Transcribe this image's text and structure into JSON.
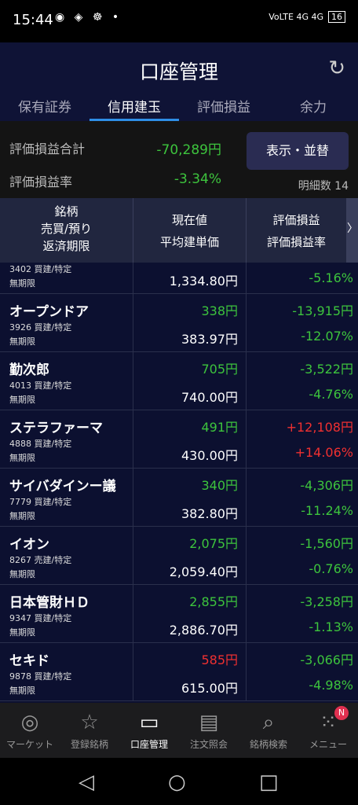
{
  "status": {
    "time": "15:44",
    "signal": "VoLTE 4G 4G",
    "battery": "16"
  },
  "header": {
    "title": "口座管理"
  },
  "tabs": [
    {
      "label": "保有証券"
    },
    {
      "label": "信用建玉"
    },
    {
      "label": "評価損益"
    },
    {
      "label": "余力"
    }
  ],
  "summary": {
    "total_label": "評価損益合計",
    "total_value": "-70,289円",
    "rate_label": "評価損益率",
    "rate_value": "-3.34%",
    "display_button": "表示・並替",
    "detail_count": "明細数 14"
  },
  "table_header": {
    "col1": [
      "銘柄",
      "売買/預り",
      "返済期限"
    ],
    "col2": [
      "現在値",
      "平均建単価"
    ],
    "col3": [
      "評価損益",
      "評価損益率"
    ],
    "arrow": "〉"
  },
  "partial_row": {
    "code": "3402 買建/特定",
    "expiry": "無期限",
    "avg": "1,334.80円",
    "rate": "-5.16%"
  },
  "rows": [
    {
      "name": "オープンドア",
      "code": "3926 買建/特定",
      "expiry": "無期限",
      "current": "338円",
      "avg": "383.97円",
      "pl": "-13,915円",
      "rate": "-12.07%",
      "cur_color": "g",
      "pl_color": "g"
    },
    {
      "name": "勤次郎",
      "code": "4013 買建/特定",
      "expiry": "無期限",
      "current": "705円",
      "avg": "740.00円",
      "pl": "-3,522円",
      "rate": "-4.76%",
      "cur_color": "g",
      "pl_color": "g"
    },
    {
      "name": "ステラファーマ",
      "code": "4888 買建/特定",
      "expiry": "無期限",
      "current": "491円",
      "avg": "430.00円",
      "pl": "+12,108円",
      "rate": "+14.06%",
      "cur_color": "g",
      "pl_color": "r"
    },
    {
      "name": "サイバダインー議",
      "code": "7779 買建/特定",
      "expiry": "無期限",
      "current": "340円",
      "avg": "382.80円",
      "pl": "-4,306円",
      "rate": "-11.24%",
      "cur_color": "g",
      "pl_color": "g"
    },
    {
      "name": "イオン",
      "code": "8267 売建/特定",
      "expiry": "無期限",
      "current": "2,075円",
      "avg": "2,059.40円",
      "pl": "-1,560円",
      "rate": "-0.76%",
      "cur_color": "g",
      "pl_color": "g"
    },
    {
      "name": "日本管財ＨＤ",
      "code": "9347 買建/特定",
      "expiry": "無期限",
      "current": "2,855円",
      "avg": "2,886.70円",
      "pl": "-3,258円",
      "rate": "-1.13%",
      "cur_color": "g",
      "pl_color": "g"
    },
    {
      "name": "セキド",
      "code": "9878 買建/特定",
      "expiry": "無期限",
      "current": "585円",
      "avg": "615.00円",
      "pl": "-3,066円",
      "rate": "-4.98%",
      "cur_color": "r",
      "pl_color": "g"
    }
  ],
  "bottom_nav": [
    {
      "label": "マーケット",
      "icon": "globe-icon"
    },
    {
      "label": "登録銘柄",
      "icon": "star-icon"
    },
    {
      "label": "口座管理",
      "icon": "card-icon"
    },
    {
      "label": "注文照会",
      "icon": "document-icon"
    },
    {
      "label": "銘柄検索",
      "icon": "search-icon"
    },
    {
      "label": "メニュー",
      "icon": "grid-icon"
    }
  ],
  "menu_badge": "N"
}
